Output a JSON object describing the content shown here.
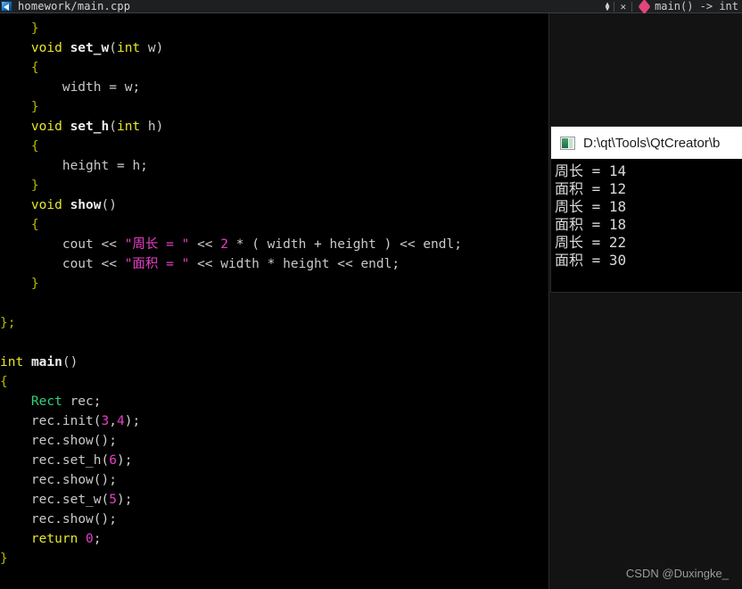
{
  "tabbar": {
    "file_icon": "document-icon",
    "file_name": "homework/main.cpp",
    "updown_glyph_up": "▲",
    "updown_glyph_down": "▼",
    "close_glyph": "✕",
    "bookmark_icon": "diamond-bookmark-icon",
    "symbol_label": "main() -> int"
  },
  "editor": {
    "background": "#000000",
    "colors": {
      "keyword": "#e7e72b",
      "function": "#eeeeee",
      "type": "#33d17a",
      "identifier": "#c9c9c9",
      "brace": "#b7b700",
      "number": "#e83fc8",
      "string": "#e83fc8"
    },
    "lines": [
      {
        "indent": 4,
        "tokens": [
          {
            "t": "br",
            "v": "}"
          }
        ]
      },
      {
        "indent": 4,
        "tokens": [
          {
            "t": "kw",
            "v": "void"
          },
          {
            "t": "op",
            "v": " "
          },
          {
            "t": "fn",
            "v": "set_w"
          },
          {
            "t": "op",
            "v": "("
          },
          {
            "t": "kw",
            "v": "int"
          },
          {
            "t": "op",
            "v": " "
          },
          {
            "t": "id",
            "v": "w"
          },
          {
            "t": "op",
            "v": ")"
          }
        ]
      },
      {
        "indent": 4,
        "tokens": [
          {
            "t": "br",
            "v": "{"
          }
        ]
      },
      {
        "indent": 8,
        "tokens": [
          {
            "t": "id",
            "v": "width"
          },
          {
            "t": "op",
            "v": " = "
          },
          {
            "t": "id",
            "v": "w"
          },
          {
            "t": "op",
            "v": ";"
          }
        ]
      },
      {
        "indent": 4,
        "tokens": [
          {
            "t": "br",
            "v": "}"
          }
        ]
      },
      {
        "indent": 4,
        "tokens": [
          {
            "t": "kw",
            "v": "void"
          },
          {
            "t": "op",
            "v": " "
          },
          {
            "t": "fn",
            "v": "set_h"
          },
          {
            "t": "op",
            "v": "("
          },
          {
            "t": "kw",
            "v": "int"
          },
          {
            "t": "op",
            "v": " "
          },
          {
            "t": "id",
            "v": "h"
          },
          {
            "t": "op",
            "v": ")"
          }
        ]
      },
      {
        "indent": 4,
        "tokens": [
          {
            "t": "br",
            "v": "{"
          }
        ]
      },
      {
        "indent": 8,
        "tokens": [
          {
            "t": "id",
            "v": "height"
          },
          {
            "t": "op",
            "v": " = "
          },
          {
            "t": "id",
            "v": "h"
          },
          {
            "t": "op",
            "v": ";"
          }
        ]
      },
      {
        "indent": 4,
        "tokens": [
          {
            "t": "br",
            "v": "}"
          }
        ]
      },
      {
        "indent": 4,
        "tokens": [
          {
            "t": "kw",
            "v": "void"
          },
          {
            "t": "op",
            "v": " "
          },
          {
            "t": "fn",
            "v": "show"
          },
          {
            "t": "op",
            "v": "()"
          }
        ]
      },
      {
        "indent": 4,
        "tokens": [
          {
            "t": "br",
            "v": "{"
          }
        ]
      },
      {
        "indent": 8,
        "tokens": [
          {
            "t": "id",
            "v": "cout"
          },
          {
            "t": "op",
            "v": " << "
          },
          {
            "t": "str",
            "v": "\"周长 = \""
          },
          {
            "t": "op",
            "v": " << "
          },
          {
            "t": "num",
            "v": "2"
          },
          {
            "t": "op",
            "v": " * ( "
          },
          {
            "t": "id",
            "v": "width"
          },
          {
            "t": "op",
            "v": " + "
          },
          {
            "t": "id",
            "v": "height"
          },
          {
            "t": "op",
            "v": " ) << "
          },
          {
            "t": "id",
            "v": "endl"
          },
          {
            "t": "op",
            "v": ";"
          }
        ]
      },
      {
        "indent": 8,
        "tokens": [
          {
            "t": "id",
            "v": "cout"
          },
          {
            "t": "op",
            "v": " << "
          },
          {
            "t": "str",
            "v": "\"面积 = \""
          },
          {
            "t": "op",
            "v": " << "
          },
          {
            "t": "id",
            "v": "width"
          },
          {
            "t": "op",
            "v": " * "
          },
          {
            "t": "id",
            "v": "height"
          },
          {
            "t": "op",
            "v": " << "
          },
          {
            "t": "id",
            "v": "endl"
          },
          {
            "t": "op",
            "v": ";"
          }
        ]
      },
      {
        "indent": 4,
        "tokens": [
          {
            "t": "br",
            "v": "}"
          }
        ]
      },
      {
        "indent": 0,
        "tokens": []
      },
      {
        "indent": 0,
        "tokens": [
          {
            "t": "br",
            "v": "};"
          }
        ]
      },
      {
        "indent": 0,
        "tokens": []
      },
      {
        "indent": 0,
        "tokens": [
          {
            "t": "kw",
            "v": "int"
          },
          {
            "t": "op",
            "v": " "
          },
          {
            "t": "fn",
            "v": "main"
          },
          {
            "t": "op",
            "v": "()"
          }
        ]
      },
      {
        "indent": 0,
        "tokens": [
          {
            "t": "br",
            "v": "{"
          }
        ]
      },
      {
        "indent": 4,
        "tokens": [
          {
            "t": "type",
            "v": "Rect"
          },
          {
            "t": "op",
            "v": " "
          },
          {
            "t": "id",
            "v": "rec"
          },
          {
            "t": "op",
            "v": ";"
          }
        ]
      },
      {
        "indent": 4,
        "tokens": [
          {
            "t": "id",
            "v": "rec"
          },
          {
            "t": "op",
            "v": "."
          },
          {
            "t": "id",
            "v": "init"
          },
          {
            "t": "op",
            "v": "("
          },
          {
            "t": "num",
            "v": "3"
          },
          {
            "t": "op",
            "v": ","
          },
          {
            "t": "num",
            "v": "4"
          },
          {
            "t": "op",
            "v": ");"
          }
        ]
      },
      {
        "indent": 4,
        "tokens": [
          {
            "t": "id",
            "v": "rec"
          },
          {
            "t": "op",
            "v": "."
          },
          {
            "t": "id",
            "v": "show"
          },
          {
            "t": "op",
            "v": "();"
          }
        ]
      },
      {
        "indent": 4,
        "tokens": [
          {
            "t": "id",
            "v": "rec"
          },
          {
            "t": "op",
            "v": "."
          },
          {
            "t": "id",
            "v": "set_h"
          },
          {
            "t": "op",
            "v": "("
          },
          {
            "t": "num",
            "v": "6"
          },
          {
            "t": "op",
            "v": ");"
          }
        ]
      },
      {
        "indent": 4,
        "tokens": [
          {
            "t": "id",
            "v": "rec"
          },
          {
            "t": "op",
            "v": "."
          },
          {
            "t": "id",
            "v": "show"
          },
          {
            "t": "op",
            "v": "();"
          }
        ]
      },
      {
        "indent": 4,
        "tokens": [
          {
            "t": "id",
            "v": "rec"
          },
          {
            "t": "op",
            "v": "."
          },
          {
            "t": "id",
            "v": "set_w"
          },
          {
            "t": "op",
            "v": "("
          },
          {
            "t": "num",
            "v": "5"
          },
          {
            "t": "op",
            "v": ");"
          }
        ]
      },
      {
        "indent": 4,
        "tokens": [
          {
            "t": "id",
            "v": "rec"
          },
          {
            "t": "op",
            "v": "."
          },
          {
            "t": "id",
            "v": "show"
          },
          {
            "t": "op",
            "v": "();"
          }
        ]
      },
      {
        "indent": 4,
        "tokens": [
          {
            "t": "kw",
            "v": "return"
          },
          {
            "t": "op",
            "v": " "
          },
          {
            "t": "num",
            "v": "0"
          },
          {
            "t": "op",
            "v": ";"
          }
        ]
      },
      {
        "indent": 0,
        "tokens": [
          {
            "t": "br",
            "v": "}"
          }
        ]
      }
    ]
  },
  "console": {
    "icon": "console-window-icon",
    "title": "D:\\qt\\Tools\\QtCreator\\b",
    "output_lines": [
      "周长 = 14",
      "面积 = 12",
      "周长 = 18",
      "面积 = 18",
      "周长 = 22",
      "面积 = 30"
    ]
  },
  "watermark": {
    "text": "CSDN @Duxingke_"
  }
}
